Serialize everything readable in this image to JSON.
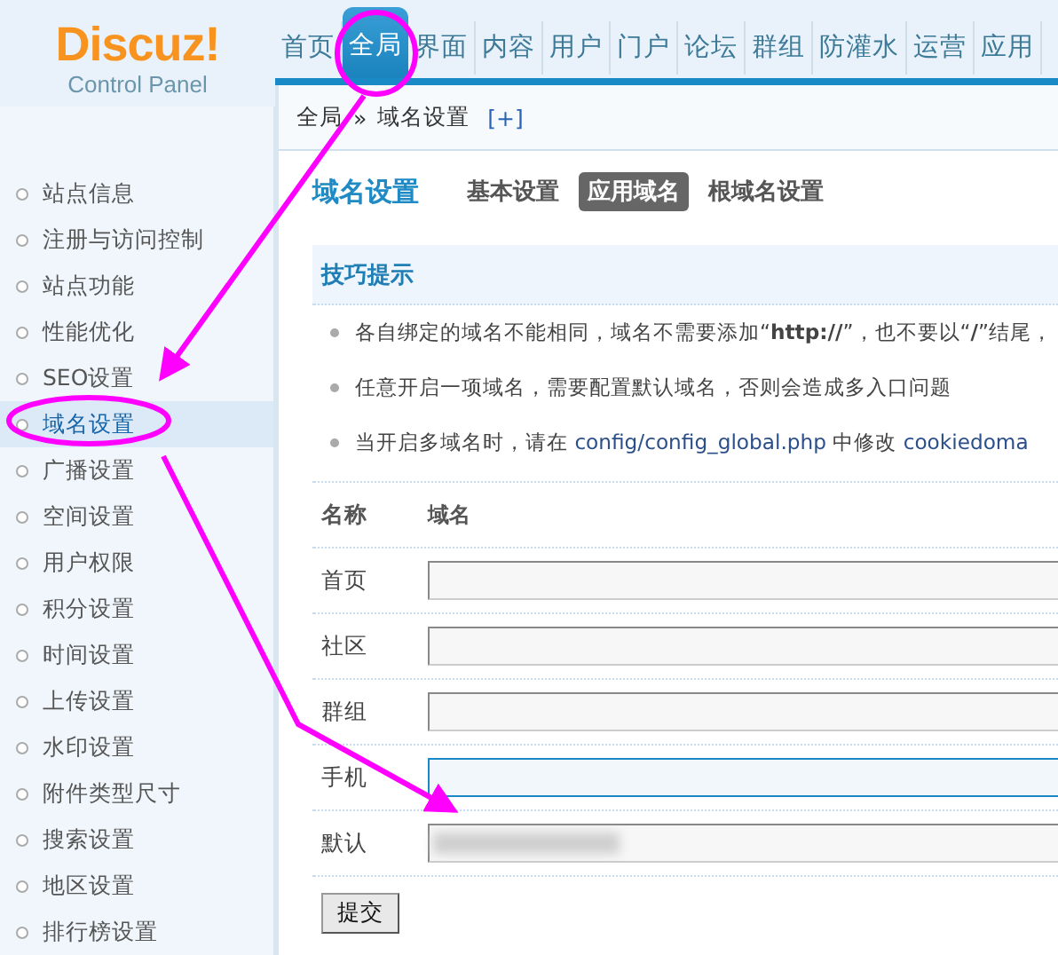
{
  "logo": {
    "brand": "Discuz!",
    "subtitle": "Control Panel"
  },
  "nav": [
    {
      "label": "首页",
      "selected": false
    },
    {
      "label": "全局",
      "selected": true
    },
    {
      "label": "界面",
      "selected": false
    },
    {
      "label": "内容",
      "selected": false
    },
    {
      "label": "用户",
      "selected": false
    },
    {
      "label": "门户",
      "selected": false
    },
    {
      "label": "论坛",
      "selected": false
    },
    {
      "label": "群组",
      "selected": false
    },
    {
      "label": "防灌水",
      "selected": false
    },
    {
      "label": "运营",
      "selected": false
    },
    {
      "label": "应用",
      "selected": false
    }
  ],
  "breadcrumb": {
    "items": [
      "全局",
      "域名设置"
    ],
    "separator": "»",
    "add_link": "[+]"
  },
  "sidebar": {
    "items": [
      {
        "label": "站点信息",
        "selected": false
      },
      {
        "label": "注册与访问控制",
        "selected": false
      },
      {
        "label": "站点功能",
        "selected": false
      },
      {
        "label": "性能优化",
        "selected": false
      },
      {
        "label": "SEO设置",
        "selected": false
      },
      {
        "label": "域名设置",
        "selected": true
      },
      {
        "label": "广播设置",
        "selected": false
      },
      {
        "label": "空间设置",
        "selected": false
      },
      {
        "label": "用户权限",
        "selected": false
      },
      {
        "label": "积分设置",
        "selected": false
      },
      {
        "label": "时间设置",
        "selected": false
      },
      {
        "label": "上传设置",
        "selected": false
      },
      {
        "label": "水印设置",
        "selected": false
      },
      {
        "label": "附件类型尺寸",
        "selected": false
      },
      {
        "label": "搜索设置",
        "selected": false
      },
      {
        "label": "地区设置",
        "selected": false
      },
      {
        "label": "排行榜设置",
        "selected": false
      }
    ]
  },
  "page": {
    "title": "域名设置",
    "tabs": [
      {
        "label": "基本设置",
        "selected": false
      },
      {
        "label": "应用域名",
        "selected": true
      },
      {
        "label": "根域名设置",
        "selected": false
      }
    ]
  },
  "tips": {
    "title": "技巧提示",
    "items": [
      {
        "segments": [
          {
            "kind": "text",
            "text": "各自绑定的域名不能相同，域名不需要添加“**http://**”，也不要以“**/**”结尾，"
          }
        ]
      },
      {
        "segments": [
          {
            "kind": "text",
            "text": "任意开启一项域名，需要配置默认域名，否则会造成多入口问题"
          }
        ]
      },
      {
        "segments": [
          {
            "kind": "text",
            "text": "当开启多域名时，请在 "
          },
          {
            "kind": "path",
            "text": "config/config_global.php"
          },
          {
            "kind": "text",
            "text": " 中修改 "
          },
          {
            "kind": "path",
            "text": "cookiedoma"
          }
        ]
      }
    ]
  },
  "form": {
    "columns": [
      "名称",
      "域名"
    ],
    "rows": [
      {
        "name": "首页",
        "focused": false,
        "blurred": false
      },
      {
        "name": "社区",
        "focused": false,
        "blurred": false
      },
      {
        "name": "群组",
        "focused": false,
        "blurred": false
      },
      {
        "name": "手机",
        "focused": true,
        "blurred": false
      },
      {
        "name": "默认",
        "focused": false,
        "blurred": true
      }
    ],
    "submit": "提交"
  }
}
